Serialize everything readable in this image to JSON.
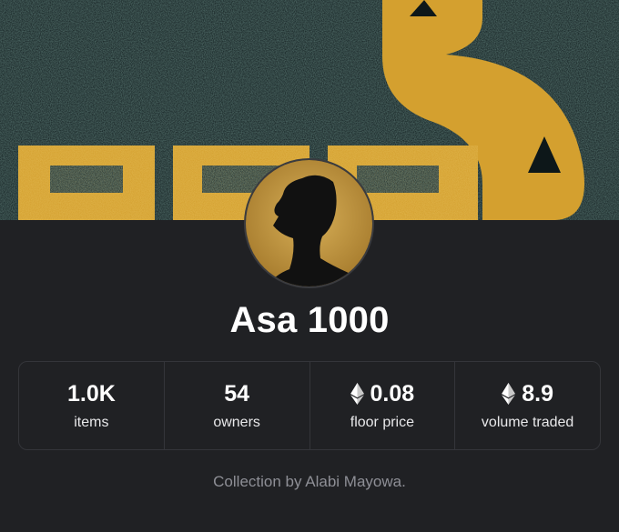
{
  "collection": {
    "title": "Asa 1000",
    "byline": "Collection by Alabi Mayowa."
  },
  "stats": [
    {
      "value": "1.0K",
      "label": "items",
      "icon": null
    },
    {
      "value": "54",
      "label": "owners",
      "icon": null
    },
    {
      "value": "0.08",
      "label": "floor price",
      "icon": "ethereum-icon"
    },
    {
      "value": "8.9",
      "label": "volume traded",
      "icon": "ethereum-icon"
    }
  ],
  "colors": {
    "background": "#202124",
    "banner_dark": "#0e1a1c",
    "banner_gold": "#d9a532",
    "border": "#34353a",
    "muted_text": "#8e8f96"
  }
}
